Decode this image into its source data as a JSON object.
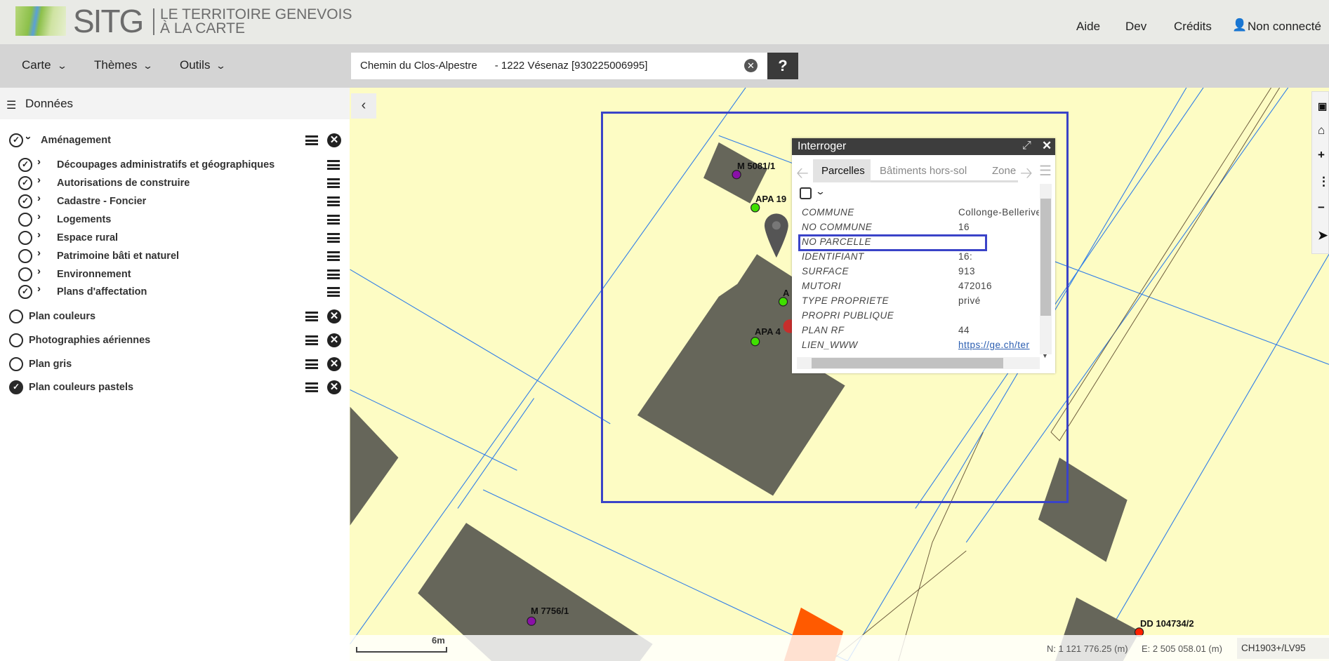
{
  "header": {
    "logo_text": "SITG",
    "logo_tagline_1": "LE TERRITOIRE GENEVOIS",
    "logo_tagline_2": "À LA CARTE",
    "links": [
      "Aide",
      "Dev",
      "Crédits"
    ],
    "user": "Non connecté"
  },
  "toolbar": {
    "menus": [
      "Carte",
      "Thèmes",
      "Outils"
    ],
    "search_value": "Chemin du Clos-Alpestre      - 1222 Vésenaz [930225006995]",
    "help_label": "?"
  },
  "sidebar": {
    "title": "Données",
    "group": {
      "label": "Aménagement",
      "checked": true,
      "items": [
        {
          "label": "Découpages administratifs et géographiques",
          "checked": true
        },
        {
          "label": "Autorisations de construire",
          "checked": true
        },
        {
          "label": "Cadastre - Foncier",
          "checked": true
        },
        {
          "label": "Logements",
          "checked": false
        },
        {
          "label": "Espace rural",
          "checked": false
        },
        {
          "label": "Patrimoine bâti et naturel",
          "checked": false
        },
        {
          "label": "Environnement",
          "checked": false
        },
        {
          "label": "Plans d'affectation",
          "checked": true
        }
      ]
    },
    "layers": [
      {
        "label": "Plan couleurs",
        "checked": false
      },
      {
        "label": "Photographies aériennes",
        "checked": false
      },
      {
        "label": "Plan gris",
        "checked": false
      },
      {
        "label": "Plan couleurs pastels",
        "checked": true
      }
    ]
  },
  "popup": {
    "title": "Interroger",
    "tabs": [
      "Parcelles",
      "Bâtiments hors-sol",
      "Zone"
    ],
    "active_tab": "Parcelles",
    "rows": [
      {
        "label": "COMMUNE",
        "value": "Collonge-Bellerive"
      },
      {
        "label": "NO COMMUNE",
        "value": "16"
      },
      {
        "label": "NO PARCELLE",
        "value": ""
      },
      {
        "label": "IDENTIFIANT",
        "value": "16:"
      },
      {
        "label": "SURFACE",
        "value": "913"
      },
      {
        "label": "MUTORI",
        "value": "472016"
      },
      {
        "label": "TYPE PROPRIETE",
        "value": "privé"
      },
      {
        "label": "PROPRI PUBLIQUE",
        "value": ""
      },
      {
        "label": "PLAN RF",
        "value": "44"
      },
      {
        "label": "LIEN_WWW",
        "value": "https://ge.ch/ter"
      }
    ]
  },
  "map": {
    "labels": [
      "M 5081/1",
      "APA 19",
      "A",
      "APA 4",
      "M 7756/1",
      "DD 104734/2"
    ],
    "scale_label": "6m",
    "north": "N: 1 121 776.25 (m)",
    "east": "E: 2 505 058.01 (m)",
    "crs": "CH1903+/LV95",
    "colors": {
      "background": "#fdfcc4",
      "building": "#66665a",
      "parcel_line": "#2f7de8",
      "highlight": "#3a43c8",
      "ddp": "#ff5a00"
    }
  }
}
